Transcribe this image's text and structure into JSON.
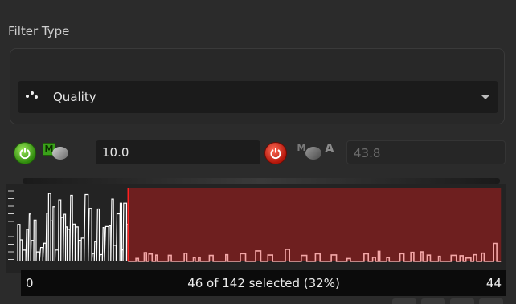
{
  "filter": {
    "title": "Filter Type",
    "type_icon": "scatter-dots-icon",
    "type_value": "Quality"
  },
  "lower": {
    "enabled": true,
    "mode_icon": "manual-disc-icon",
    "mode_letter": "M",
    "value": "10.0"
  },
  "upper": {
    "enabled": false,
    "mode_icon": "manual-auto-disc-icon",
    "mode_letter": "M",
    "auto_letter": "A",
    "value": "43.8"
  },
  "histogram": {
    "min_label": "0",
    "max_label": "44",
    "status": "46 of 142 selected (32%)",
    "colors": {
      "selected_fill": "#6e1f1f",
      "selected_line": "#f4a7a7",
      "unselected_line": "#ffffff",
      "threshold": "#ff2020"
    }
  },
  "chart_data": {
    "type": "bar",
    "x_range": [
      0,
      44
    ],
    "selection_range": [
      10.0,
      43.8
    ]
  }
}
